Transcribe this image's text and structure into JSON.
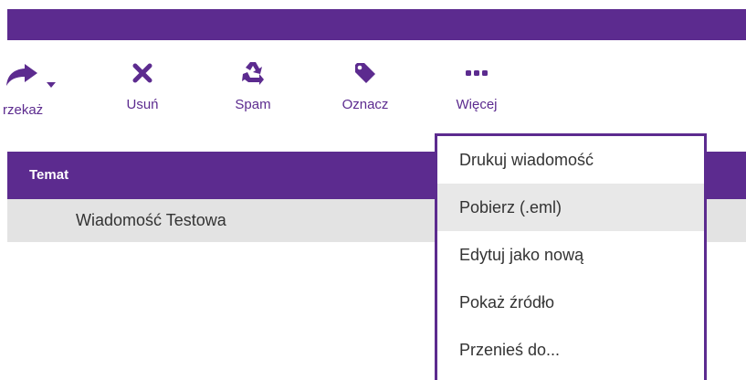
{
  "toolbar": {
    "forward_label": "rzekaż",
    "delete_label": "Usuń",
    "spam_label": "Spam",
    "tag_label": "Oznacz",
    "more_label": "Więcej"
  },
  "table": {
    "header": "Temat",
    "rows": [
      {
        "subject": "Wiadomość Testowa"
      }
    ]
  },
  "more_menu": {
    "items": [
      {
        "label": "Drukuj wiadomość"
      },
      {
        "label": "Pobierz (.eml)"
      },
      {
        "label": "Edytuj jako nową"
      },
      {
        "label": "Pokaż źródło"
      },
      {
        "label": "Przenieś do..."
      }
    ]
  },
  "colors": {
    "accent": "#5c2b8f",
    "row_selected": "#e3e3e3",
    "menu_hover": "#e8e8e8"
  },
  "icons": [
    "forward-icon",
    "dropdown-caret-icon",
    "close-icon",
    "recycle-icon",
    "tag-icon",
    "more-dots-icon"
  ]
}
